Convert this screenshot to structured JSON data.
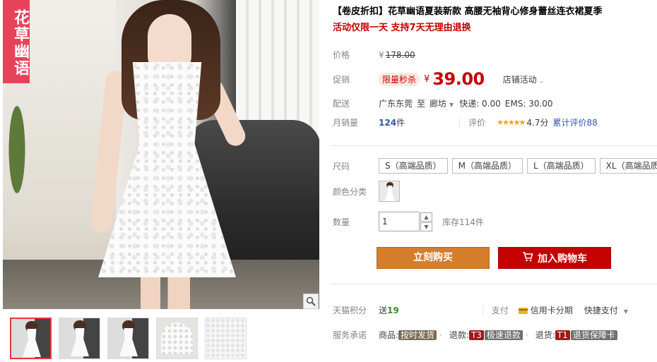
{
  "brand_tag": "花草幽语",
  "product": {
    "title": "【卷皮折扣】花草幽语夏装新款 高腰无袖背心修身蕾丝连衣裙夏季",
    "subtitle": "活动仅限一天 支持7天无理由退换"
  },
  "price": {
    "label": "价格",
    "currency": "¥",
    "original": "178.00"
  },
  "promo": {
    "label": "促销",
    "tag": "限量秒杀",
    "currency": "¥",
    "price": "39.00",
    "shop_activity": "店铺活动"
  },
  "shipping": {
    "label": "配送",
    "from": "广东东莞",
    "to_word": "至",
    "to": "廊坊",
    "express": "快递: 0.00",
    "ems": "EMS: 30.00"
  },
  "sales": {
    "label": "月销量",
    "count": "124",
    "unit": "件",
    "review_label": "评价",
    "stars": "★★★★★",
    "rating": "4.7分",
    "review_total": "累计评价88"
  },
  "size": {
    "label": "尺码",
    "options": [
      "S（高端品质）",
      "M（高端品质）",
      "L（高端品质）",
      "XL（高端品质）"
    ]
  },
  "color": {
    "label": "颜色分类"
  },
  "quantity": {
    "label": "数量",
    "value": "1",
    "up": "▲",
    "down": "▼",
    "stock": "库存114件"
  },
  "buttons": {
    "buy_now": "立刻购买",
    "add_cart": "加入购物车"
  },
  "points": {
    "label": "天猫积分",
    "prefix": "送",
    "value": "19",
    "pay_label": "支付",
    "credit_installment": "信用卡分期",
    "quick_pay": "快捷支付"
  },
  "service": {
    "label": "服务承诺",
    "items": [
      {
        "prefix": "商品:",
        "tag": "",
        "text": "按时发货"
      },
      {
        "prefix": "退款:",
        "tag": "T3",
        "text": "极速退款"
      },
      {
        "prefix": "退货:",
        "tag": "T1",
        "text": "退货保障卡"
      }
    ]
  },
  "colors": {
    "accent_red": "#c40000",
    "buy_orange": "#d47d2b",
    "brand_pink": "#e8425a"
  },
  "icons": [
    "zoom-icon",
    "cart-icon",
    "chevron-down-icon",
    "credit-card-icon"
  ]
}
